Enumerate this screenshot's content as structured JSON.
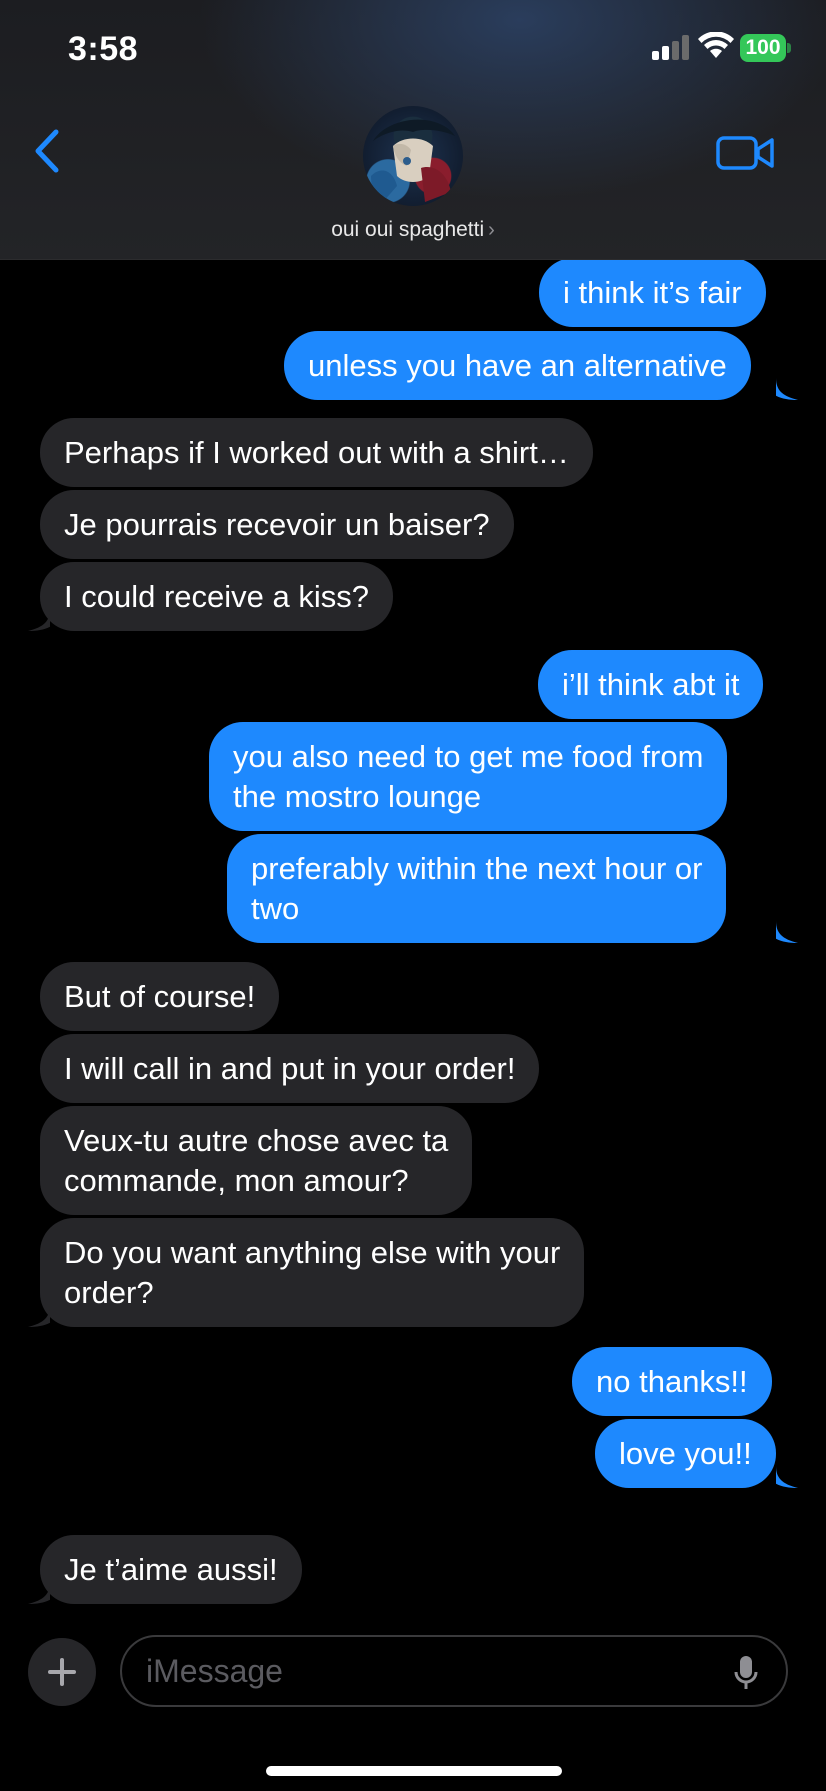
{
  "status_bar": {
    "time": "3:58",
    "battery": "100"
  },
  "contact": {
    "name": "oui oui spaghetti",
    "chevron": "›"
  },
  "messages": [
    {
      "text": "i think it’s fair",
      "from": "me"
    },
    {
      "text": "unless you have an alternative",
      "from": "me"
    },
    {
      "text": "Perhaps if I worked out with a shirt…",
      "from": "them"
    },
    {
      "text": "Je pourrais recevoir un baiser?",
      "from": "them"
    },
    {
      "text": "I could receive a kiss?",
      "from": "them"
    },
    {
      "text": "i’ll think abt it",
      "from": "me"
    },
    {
      "lines": [
        "you also need to get me food from",
        "the mostro lounge"
      ],
      "from": "me"
    },
    {
      "lines": [
        "preferably within the next hour or",
        "two"
      ],
      "from": "me"
    },
    {
      "text": "But of course!",
      "from": "them"
    },
    {
      "text": "I will call in and put in your order!",
      "from": "them"
    },
    {
      "lines": [
        "Veux-tu autre chose avec ta",
        "commande, mon amour?"
      ],
      "from": "them"
    },
    {
      "lines": [
        "Do you want anything else with your",
        "order?"
      ],
      "from": "them"
    },
    {
      "text": "no thanks!!",
      "from": "me"
    },
    {
      "text": "love you!!",
      "from": "me"
    },
    {
      "text": "Je t’aime aussi!",
      "from": "them"
    }
  ],
  "composer": {
    "placeholder": "iMessage"
  },
  "colors": {
    "sent_bubble": "#1e89fe",
    "received_bubble": "#262629",
    "accent": "#1e89fe",
    "battery": "#34c759"
  },
  "icons": [
    "back-chevron-icon",
    "video-camera-icon",
    "plus-icon",
    "microphone-icon",
    "wifi-icon",
    "signal-icon"
  ]
}
